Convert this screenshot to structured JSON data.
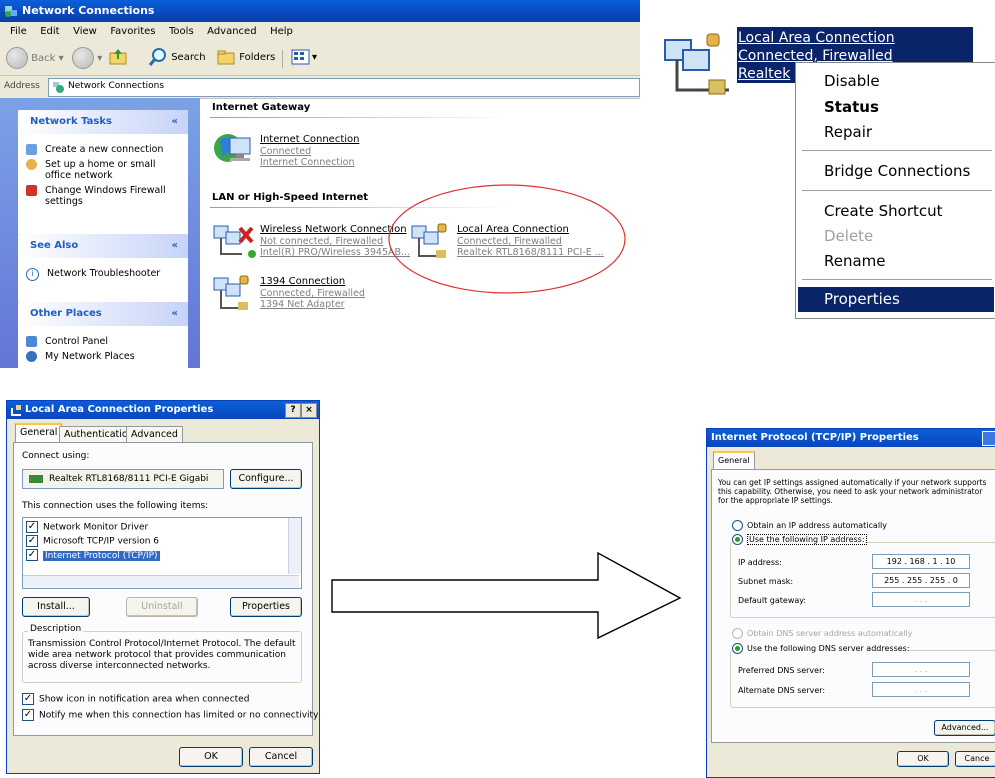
{
  "explorer": {
    "title": "Network Connections",
    "menu": [
      "File",
      "Edit",
      "View",
      "Favorites",
      "Tools",
      "Advanced",
      "Help"
    ],
    "toolbar": {
      "back": "Back",
      "search": "Search",
      "folders": "Folders"
    },
    "address_label": "Address",
    "address_value": "Network Connections",
    "network_tasks": {
      "title": "Network Tasks",
      "items": [
        "Create a new connection",
        "Set up a home or small office network",
        "Change Windows Firewall settings"
      ]
    },
    "see_also": {
      "title": "See Also",
      "items": [
        "Network Troubleshooter"
      ]
    },
    "other_places": {
      "title": "Other Places",
      "items": [
        "Control Panel",
        "My Network Places"
      ]
    },
    "groups": {
      "gateway": "Internet Gateway",
      "lan": "LAN or High-Speed Internet"
    },
    "connections": {
      "internet": {
        "name": "Internet Connection",
        "status": "Connected",
        "device": "Internet Connection"
      },
      "wireless": {
        "name": "Wireless Network Connection",
        "status": "Not connected, Firewalled",
        "device": "Intel(R) PRO/Wireless 3945AB..."
      },
      "lan": {
        "name": "Local Area Connection",
        "status": "Connected, Firewalled",
        "device": "Realtek RTL8168/8111 PCI-E ..."
      },
      "c1394": {
        "name": "1394 Connection",
        "status": "Connected, Firewalled",
        "device": "1394 Net Adapter"
      }
    }
  },
  "context_snippet": {
    "name": "Local Area Connection",
    "status": "Connected, Firewalled",
    "device": "Realtek",
    "menu": {
      "disable": "Disable",
      "status": "Status",
      "repair": "Repair",
      "bridge": "Bridge Connections",
      "shortcut": "Create Shortcut",
      "delete": "Delete",
      "rename": "Rename",
      "properties": "Properties"
    }
  },
  "lac_dialog": {
    "title": "Local Area Connection Properties",
    "title_buttons": [
      "?",
      "×"
    ],
    "tabs": [
      "General",
      "Authentication",
      "Advanced"
    ],
    "connect_using": "Connect using:",
    "adapter": "Realtek RTL8168/8111 PCI-E Gigabi",
    "configure": "Configure...",
    "items_label": "This connection uses the following items:",
    "items": [
      {
        "label": "Network Monitor Driver",
        "checked": true
      },
      {
        "label": "Microsoft TCP/IP version 6",
        "checked": true
      },
      {
        "label": "Internet Protocol (TCP/IP)",
        "checked": true
      }
    ],
    "install": "Install...",
    "uninstall": "Uninstall",
    "properties": "Properties",
    "description_label": "Description",
    "description": "Transmission Control Protocol/Internet Protocol. The default wide area network protocol that provides communication across diverse interconnected networks.",
    "show_icon": "Show icon in notification area when connected",
    "notify": "Notify me when this connection has limited or no connectivity",
    "ok": "OK",
    "cancel": "Cancel"
  },
  "tcp_dialog": {
    "title": "Internet Protocol (TCP/IP) Properties",
    "tab": "General",
    "intro": "You can get IP settings assigned automatically if your network supports this capability. Otherwise, you need to ask your network administrator for the appropriate IP settings.",
    "obtain_ip": "Obtain an IP address automatically",
    "use_ip": "Use the following IP address:",
    "ip_label": "IP address:",
    "ip_value": "192 . 168 . 1 . 10",
    "mask_label": "Subnet mask:",
    "mask_value": "255 . 255 . 255 . 0",
    "gateway_label": "Default gateway:",
    "empty_ip": ". . .",
    "obtain_dns": "Obtain DNS server address automatically",
    "use_dns": "Use the following DNS server addresses:",
    "pref_dns": "Preferred DNS server:",
    "alt_dns": "Alternate DNS server:",
    "advanced": "Advanced...",
    "ok": "OK",
    "cancel": "Cance"
  },
  "colors": {
    "xp_blue": "#0a5fd8",
    "selection": "#0a246a",
    "highlight_circle": "#e03030"
  }
}
